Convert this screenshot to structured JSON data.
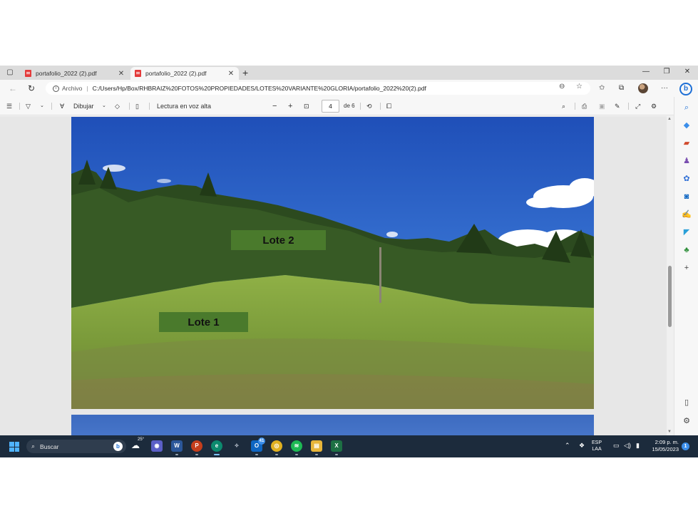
{
  "browser": {
    "tabs": [
      {
        "title": "portafolio_2022 (2).pdf",
        "active": false
      },
      {
        "title": "portafolio_2022 (2).pdf",
        "active": true
      }
    ],
    "address": {
      "security_label": "Archivo",
      "url": "C:/Users/Hp/Box/RHBRAIZ%20FOTOS%20PROPIEDADES/LOTES%20VARIANTE%20GLORIA/portafolio_2022%20(2).pdf"
    }
  },
  "pdf_toolbar": {
    "draw_label": "Dibujar",
    "read_aloud_label": "Lectura en voz alta",
    "page_current": "4",
    "page_total_label": "de 6"
  },
  "document": {
    "labels": {
      "lote2": "Lote  2",
      "lote1": "Lote 1"
    },
    "label_color": "#4a7a2c"
  },
  "taskbar": {
    "search_placeholder": "Buscar",
    "weather_temp": "25°",
    "outlook_badge": "41",
    "lang_primary": "ESP",
    "lang_secondary": "LAA",
    "time": "2:09 p. m.",
    "date": "15/05/2023",
    "notifications": "1"
  },
  "colors": {
    "taskbar_bg": "#1c2b3c",
    "accent": "#1d6fd6"
  }
}
